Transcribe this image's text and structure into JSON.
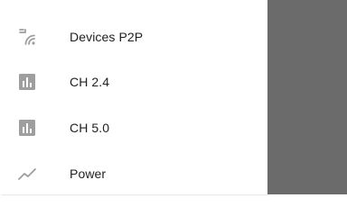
{
  "menu": {
    "items": [
      {
        "label": "Devices P2P",
        "icon": "wifi-p2p-icon"
      },
      {
        "label": "CH 2.4",
        "icon": "bar-chart-icon"
      },
      {
        "label": "CH 5.0",
        "icon": "bar-chart-icon"
      },
      {
        "label": "Power",
        "icon": "trending-line-icon"
      }
    ]
  },
  "colors": {
    "icon": "#9e9e9e",
    "text": "#212121",
    "drawer_bg": "#ffffff",
    "scrim": "#6b6b6b"
  }
}
